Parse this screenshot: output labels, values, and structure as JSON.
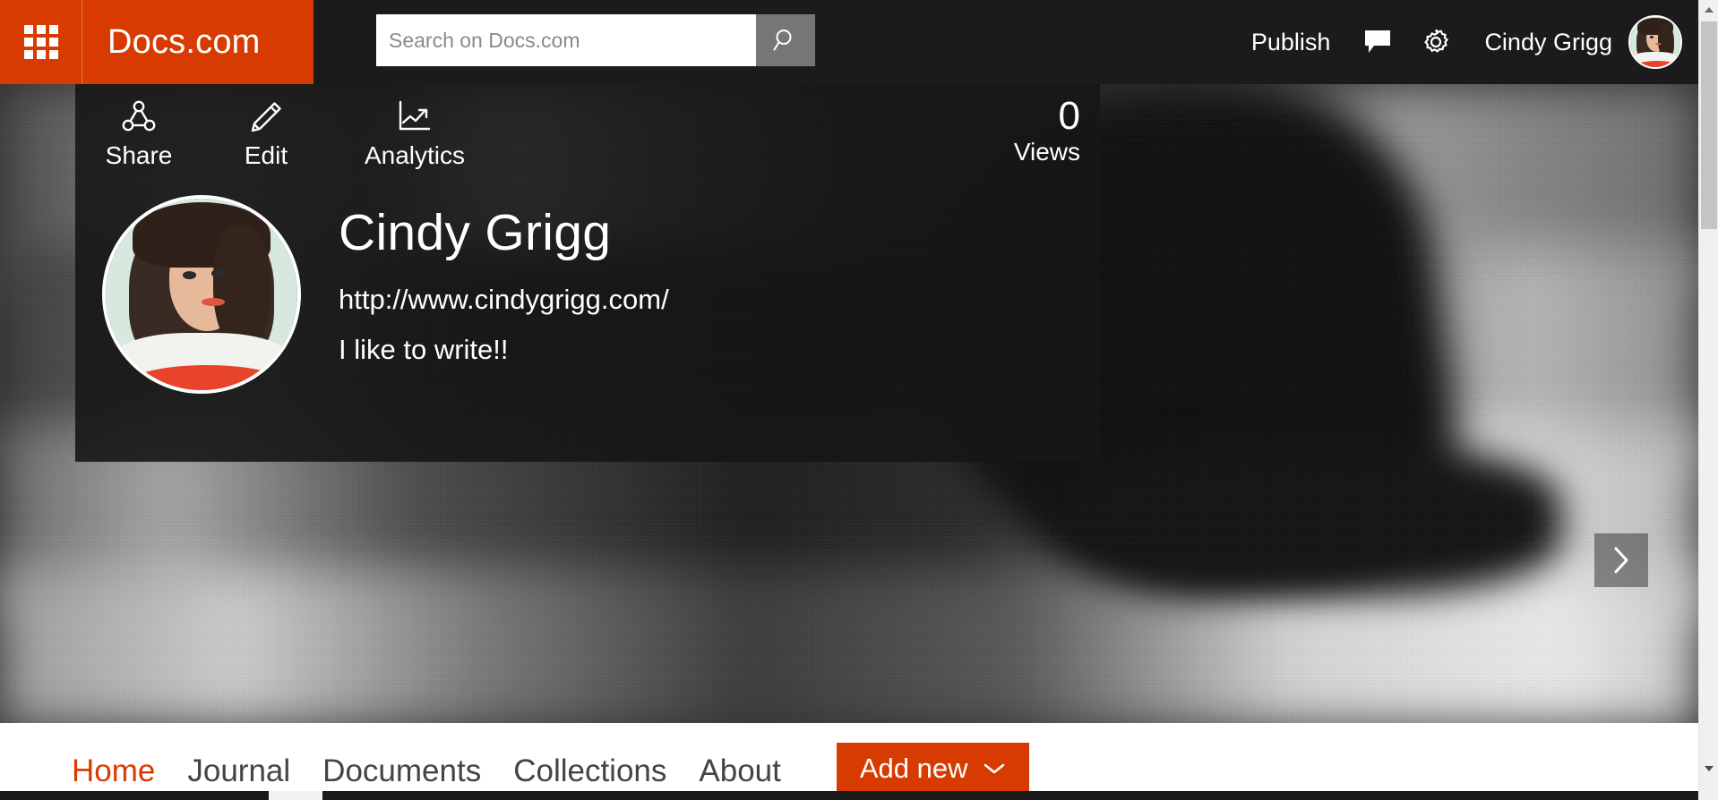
{
  "suitebar": {
    "waffle_label": "app-launcher",
    "brand": "Docs.com",
    "search": {
      "placeholder": "Search on Docs.com",
      "value": "",
      "button_label": "Search"
    },
    "publish_label": "Publish",
    "feedback_label": "Feedback",
    "settings_label": "Settings",
    "user_name": "Cindy Grigg",
    "avatar_alt": "Cindy Grigg"
  },
  "hero": {
    "alt": "Black and white motion-blurred photo of a runner",
    "next_label": "Next"
  },
  "profile": {
    "actions": [
      {
        "id": "share",
        "label": "Share",
        "icon": "share-icon"
      },
      {
        "id": "edit",
        "label": "Edit",
        "icon": "pencil-icon"
      },
      {
        "id": "analytics",
        "label": "Analytics",
        "icon": "analytics-chart-icon"
      }
    ],
    "views": {
      "count": "0",
      "label": "Views"
    },
    "display_name": "Cindy Grigg",
    "website": "http://www.cindygrigg.com/",
    "bio": "I like to write!!",
    "avatar_alt": "Cindy Grigg profile photo"
  },
  "pagenav": {
    "links": [
      {
        "label": "Home",
        "active": true
      },
      {
        "label": "Journal",
        "active": false
      },
      {
        "label": "Documents",
        "active": false
      },
      {
        "label": "Collections",
        "active": false
      },
      {
        "label": "About",
        "active": false
      }
    ],
    "add_new_label": "Add new"
  },
  "colors": {
    "brand_orange": "#d83b01",
    "suitebar_bg": "#1b1b1b",
    "card_bg": "rgba(22,22,22,0.90)",
    "nav_text": "#444444",
    "active_nav": "#d83b01"
  }
}
